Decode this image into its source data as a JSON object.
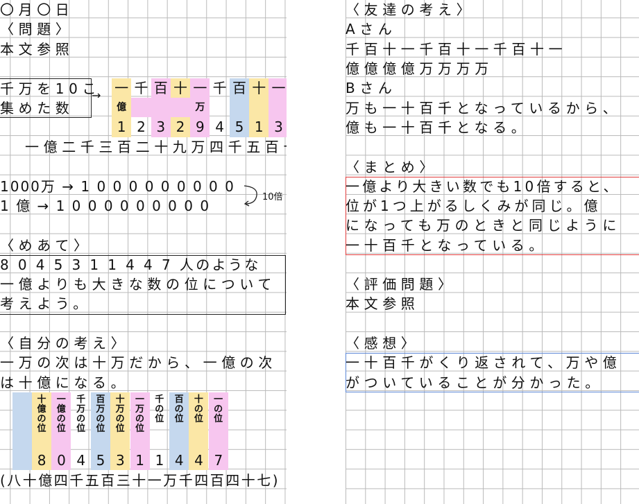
{
  "left": {
    "date": "〇月〇日",
    "mondai_heading": "〈問題〉",
    "mondai_body": "本文参照",
    "box_text_1": "千万を10こ",
    "box_text_2": "集めた数",
    "place_row": [
      "一",
      "千",
      "百",
      "十",
      "一",
      "千",
      "百",
      "十",
      "一"
    ],
    "oku_label": "億",
    "man_label": "万",
    "digits": [
      "1",
      "2",
      "3",
      "2",
      "9",
      "4",
      "5",
      "1",
      "3"
    ],
    "reading": "一億二千三百二十九万四千五百十三",
    "eq1_left": "1000万",
    "eq1_right": "1 0 0 0 0 0 0 0 0 0",
    "eq2_left": "1 億",
    "eq2_right": "1 0 0 0 0 0 0 0 0 0",
    "times10": "10倍",
    "meate_heading": "〈めあて〉",
    "meate_1": "8 0 4 5 3 1 1 4 4 7 人のような",
    "meate_2": "一億よりも大きな数の位について",
    "meate_3": "考えよう。",
    "jibun_heading": "〈自分の考え〉",
    "jibun_1": "一万の次は十万だから、一億の次",
    "jibun_2": "は十億になる。",
    "places": [
      "十億の位",
      "一億の位",
      "千万の位",
      "百万の位",
      "十万の位",
      "一万の位",
      "千の位",
      "百の位",
      "十の位",
      "一の位"
    ],
    "digits2": [
      "8",
      "0",
      "4",
      "5",
      "3",
      "1",
      "1",
      "4",
      "4",
      "7"
    ],
    "reading2": "(八十億四千五百三十一万千四百四十七)"
  },
  "right": {
    "tomodachi_heading": "〈友達の考え〉",
    "a_san": "Aさん",
    "a_line1": "千百十一千百十一千百十一",
    "a_line2": "億億億億万万万万",
    "b_san": "Bさん",
    "b_line1": "万も一十百千となっているから、",
    "b_line2": "億も一十百千となる。",
    "matome_heading": "〈まとめ〉",
    "matome_1": "一億より大きい数でも10倍すると、",
    "matome_2": "位が1つ上がるしくみが同じ。億",
    "matome_3": "になっても万のときと同じように",
    "matome_4": "一十百千となっている。",
    "hyouka_heading": "〈評価問題〉",
    "hyouka_body": "本文参照",
    "kansou_heading": "〈感想〉",
    "kansou_1": "一十百千がくり返されて、万や億",
    "kansou_2": "がついていることが分かった。"
  },
  "colors": {
    "yellow": "#fbe7a6",
    "pink": "#f7c6ef",
    "blue": "#c5d8ee",
    "matome_border": "#e03a3a",
    "kansou_border": "#5b86d6"
  }
}
